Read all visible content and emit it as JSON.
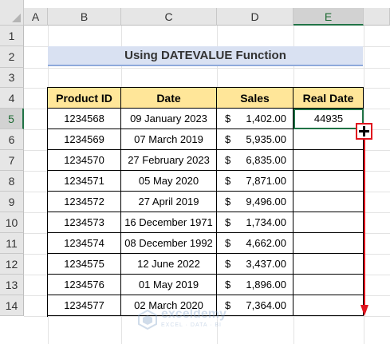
{
  "columns": [
    "A",
    "B",
    "C",
    "D",
    "E"
  ],
  "selected_column": "E",
  "rows": [
    "1",
    "2",
    "3",
    "4",
    "5",
    "6",
    "7",
    "8",
    "9",
    "10",
    "11",
    "12",
    "13",
    "14"
  ],
  "selected_row": "5",
  "title": "Using DATEVALUE Function",
  "table": {
    "headers": [
      "Product ID",
      "Date",
      "Sales",
      "Real Date"
    ],
    "currency_symbol": "$",
    "rows": [
      {
        "id": "1234568",
        "date": "09 January 2023",
        "sales": "1,402.00",
        "real": "44935"
      },
      {
        "id": "1234569",
        "date": "07 March 2019",
        "sales": "5,935.00",
        "real": ""
      },
      {
        "id": "1234570",
        "date": "27 February 2023",
        "sales": "6,835.00",
        "real": ""
      },
      {
        "id": "1234571",
        "date": "05 May 2020",
        "sales": "7,871.00",
        "real": ""
      },
      {
        "id": "1234572",
        "date": "27 April 2019",
        "sales": "9,496.00",
        "real": ""
      },
      {
        "id": "1234573",
        "date": "16 December 1971",
        "sales": "1,734.00",
        "real": ""
      },
      {
        "id": "1234574",
        "date": "08 December 1992",
        "sales": "4,662.00",
        "real": ""
      },
      {
        "id": "1234575",
        "date": "12 June 2022",
        "sales": "3,437.00",
        "real": ""
      },
      {
        "id": "1234576",
        "date": "01 May 2019",
        "sales": "1,896.00",
        "real": ""
      },
      {
        "id": "1234577",
        "date": "02 March 2020",
        "sales": "7,364.00",
        "real": ""
      }
    ]
  },
  "watermark": {
    "name": "exceldemy",
    "tagline": "EXCEL · DATA · BI"
  },
  "colors": {
    "accent": "#217346",
    "header_fill": "#ffe699",
    "title_fill": "#d9e1f2",
    "arrow": "#e0141e"
  }
}
